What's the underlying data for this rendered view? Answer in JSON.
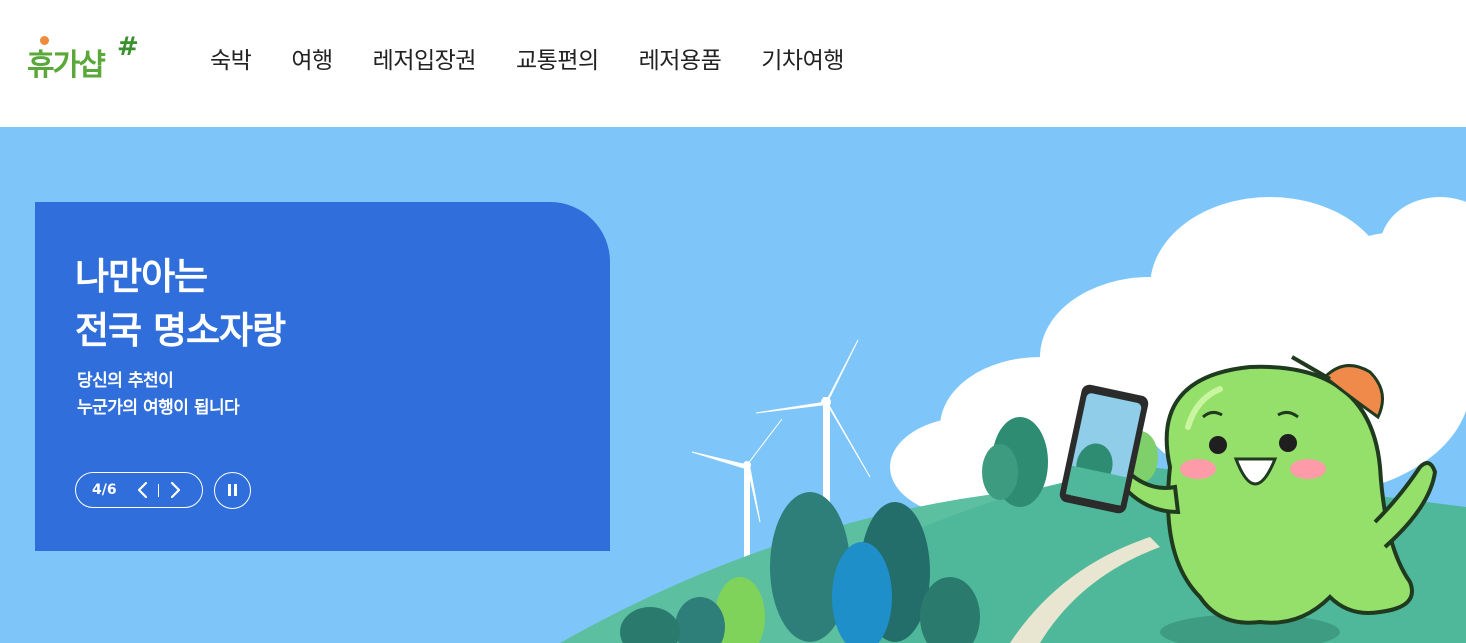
{
  "header": {
    "logo_text": "휴가샵",
    "logo_mark": "#",
    "nav": [
      {
        "label": "숙박"
      },
      {
        "label": "여행"
      },
      {
        "label": "레저입장권"
      },
      {
        "label": "교통편의"
      },
      {
        "label": "레저용품"
      },
      {
        "label": "기차여행"
      }
    ]
  },
  "hero": {
    "title_line1": "나만아는",
    "title_line2": "전국 명소자랑",
    "subtitle_line1": "당신의 추천이",
    "subtitle_line2": "누군가의 여행이 됩니다",
    "pager": {
      "current": 4,
      "total": 6,
      "label": "4/6"
    },
    "icons": {
      "prev": "chevron-left-icon",
      "next": "chevron-right-icon",
      "pause": "pause-icon"
    }
  },
  "colors": {
    "sky": "#7ec6f9",
    "banner": "#2f6edb",
    "logo_green": "#5aa83a",
    "character_green": "#94e06a",
    "hill": "#4fb89a"
  }
}
